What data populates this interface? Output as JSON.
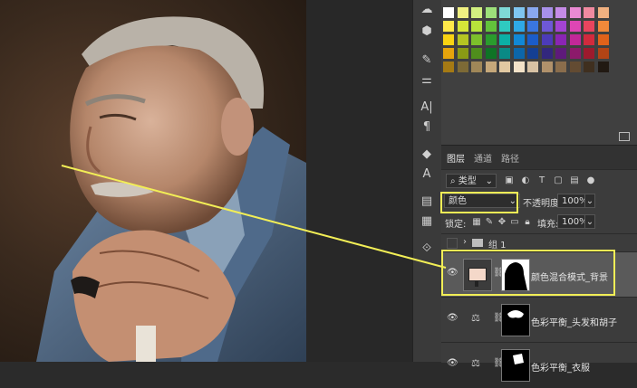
{
  "tools": [
    "creative-cloud-icon",
    "3d-cube-icon",
    "brush-settings-icon",
    "adjust-sliders-icon",
    "character-icon",
    "paragraph-icon",
    "clone-source-icon",
    "type-shapes-icon",
    "libraries-icon",
    "document-icon",
    "share-icon"
  ],
  "tool_glyphs": [
    "☁",
    "⬢",
    "✎",
    "⚌",
    "A|",
    "¶",
    "◆",
    "A",
    "▤",
    "▦",
    "⟐"
  ],
  "swatch_colors": [
    [
      "#ffffff",
      "#f0f081",
      "#d2f080",
      "#9de07a",
      "#7fd9d6",
      "#7fc5f0",
      "#89a8ef",
      "#a890ea",
      "#c58be7",
      "#ea8ad4",
      "#f08aa0",
      "#f0b080"
    ],
    [
      "#ffe94a",
      "#d6e638",
      "#b7e43b",
      "#63c33b",
      "#2fcac0",
      "#2fa9e6",
      "#3a76e0",
      "#6e58d6",
      "#a344d3",
      "#de46b4",
      "#e8455e",
      "#f0893a"
    ],
    [
      "#f9d312",
      "#b5c522",
      "#7cc02b",
      "#2a9c2d",
      "#0bb0a6",
      "#1188d6",
      "#1b5cc9",
      "#4c3bb8",
      "#8a25b3",
      "#c22898",
      "#d22a3d",
      "#e0621a"
    ],
    [
      "#e6a40c",
      "#8a9a15",
      "#4f8e1c",
      "#0f7326",
      "#0a8a85",
      "#0c66a9",
      "#143f93",
      "#32277d",
      "#5e1a7b",
      "#8c1a6b",
      "#9d1a2d",
      "#b24415"
    ],
    [
      "#a57a14",
      "#7d6a36",
      "#a08758",
      "#c6a87a",
      "#e2c9a2",
      "#f3e2c8",
      "#d8c2a4",
      "#b0916b",
      "#8a6d4c",
      "#634b32",
      "#3f2f1f",
      "#211912"
    ]
  ],
  "layers_panel": {
    "tabs": [
      "图层",
      "通道",
      "路径"
    ],
    "filter_label": "类型",
    "blend_mode": "颜色",
    "opacity_label": "不透明度:",
    "opacity_value": "100%",
    "lock_label": "锁定:",
    "fill_label": "填充:",
    "fill_value": "100%",
    "group_name": "组 1",
    "layers": [
      {
        "name": "颜色混合模式_背景",
        "type": "fill",
        "selected": true
      },
      {
        "name": "色彩平衡_头发和胡子",
        "type": "adjustment",
        "selected": false
      },
      {
        "name": "色彩平衡_衣服",
        "type": "adjustment",
        "selected": false
      }
    ]
  },
  "colors": {
    "highlight": "#f2ee56",
    "selected_row": "#5a5a5a"
  }
}
